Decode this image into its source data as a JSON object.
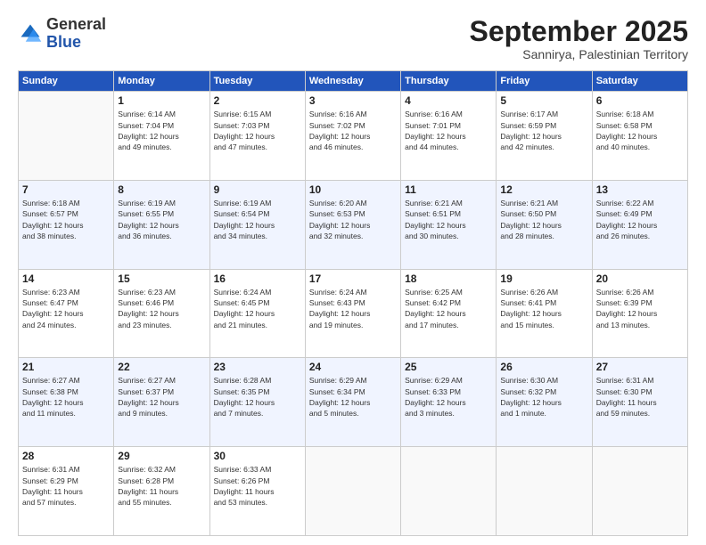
{
  "logo": {
    "general": "General",
    "blue": "Blue"
  },
  "header": {
    "month": "September 2025",
    "location": "Sannirya, Palestinian Territory"
  },
  "weekdays": [
    "Sunday",
    "Monday",
    "Tuesday",
    "Wednesday",
    "Thursday",
    "Friday",
    "Saturday"
  ],
  "weeks": [
    [
      {
        "day": "",
        "info": ""
      },
      {
        "day": "1",
        "info": "Sunrise: 6:14 AM\nSunset: 7:04 PM\nDaylight: 12 hours\nand 49 minutes."
      },
      {
        "day": "2",
        "info": "Sunrise: 6:15 AM\nSunset: 7:03 PM\nDaylight: 12 hours\nand 47 minutes."
      },
      {
        "day": "3",
        "info": "Sunrise: 6:16 AM\nSunset: 7:02 PM\nDaylight: 12 hours\nand 46 minutes."
      },
      {
        "day": "4",
        "info": "Sunrise: 6:16 AM\nSunset: 7:01 PM\nDaylight: 12 hours\nand 44 minutes."
      },
      {
        "day": "5",
        "info": "Sunrise: 6:17 AM\nSunset: 6:59 PM\nDaylight: 12 hours\nand 42 minutes."
      },
      {
        "day": "6",
        "info": "Sunrise: 6:18 AM\nSunset: 6:58 PM\nDaylight: 12 hours\nand 40 minutes."
      }
    ],
    [
      {
        "day": "7",
        "info": "Sunrise: 6:18 AM\nSunset: 6:57 PM\nDaylight: 12 hours\nand 38 minutes."
      },
      {
        "day": "8",
        "info": "Sunrise: 6:19 AM\nSunset: 6:55 PM\nDaylight: 12 hours\nand 36 minutes."
      },
      {
        "day": "9",
        "info": "Sunrise: 6:19 AM\nSunset: 6:54 PM\nDaylight: 12 hours\nand 34 minutes."
      },
      {
        "day": "10",
        "info": "Sunrise: 6:20 AM\nSunset: 6:53 PM\nDaylight: 12 hours\nand 32 minutes."
      },
      {
        "day": "11",
        "info": "Sunrise: 6:21 AM\nSunset: 6:51 PM\nDaylight: 12 hours\nand 30 minutes."
      },
      {
        "day": "12",
        "info": "Sunrise: 6:21 AM\nSunset: 6:50 PM\nDaylight: 12 hours\nand 28 minutes."
      },
      {
        "day": "13",
        "info": "Sunrise: 6:22 AM\nSunset: 6:49 PM\nDaylight: 12 hours\nand 26 minutes."
      }
    ],
    [
      {
        "day": "14",
        "info": "Sunrise: 6:23 AM\nSunset: 6:47 PM\nDaylight: 12 hours\nand 24 minutes."
      },
      {
        "day": "15",
        "info": "Sunrise: 6:23 AM\nSunset: 6:46 PM\nDaylight: 12 hours\nand 23 minutes."
      },
      {
        "day": "16",
        "info": "Sunrise: 6:24 AM\nSunset: 6:45 PM\nDaylight: 12 hours\nand 21 minutes."
      },
      {
        "day": "17",
        "info": "Sunrise: 6:24 AM\nSunset: 6:43 PM\nDaylight: 12 hours\nand 19 minutes."
      },
      {
        "day": "18",
        "info": "Sunrise: 6:25 AM\nSunset: 6:42 PM\nDaylight: 12 hours\nand 17 minutes."
      },
      {
        "day": "19",
        "info": "Sunrise: 6:26 AM\nSunset: 6:41 PM\nDaylight: 12 hours\nand 15 minutes."
      },
      {
        "day": "20",
        "info": "Sunrise: 6:26 AM\nSunset: 6:39 PM\nDaylight: 12 hours\nand 13 minutes."
      }
    ],
    [
      {
        "day": "21",
        "info": "Sunrise: 6:27 AM\nSunset: 6:38 PM\nDaylight: 12 hours\nand 11 minutes."
      },
      {
        "day": "22",
        "info": "Sunrise: 6:27 AM\nSunset: 6:37 PM\nDaylight: 12 hours\nand 9 minutes."
      },
      {
        "day": "23",
        "info": "Sunrise: 6:28 AM\nSunset: 6:35 PM\nDaylight: 12 hours\nand 7 minutes."
      },
      {
        "day": "24",
        "info": "Sunrise: 6:29 AM\nSunset: 6:34 PM\nDaylight: 12 hours\nand 5 minutes."
      },
      {
        "day": "25",
        "info": "Sunrise: 6:29 AM\nSunset: 6:33 PM\nDaylight: 12 hours\nand 3 minutes."
      },
      {
        "day": "26",
        "info": "Sunrise: 6:30 AM\nSunset: 6:32 PM\nDaylight: 12 hours\nand 1 minute."
      },
      {
        "day": "27",
        "info": "Sunrise: 6:31 AM\nSunset: 6:30 PM\nDaylight: 11 hours\nand 59 minutes."
      }
    ],
    [
      {
        "day": "28",
        "info": "Sunrise: 6:31 AM\nSunset: 6:29 PM\nDaylight: 11 hours\nand 57 minutes."
      },
      {
        "day": "29",
        "info": "Sunrise: 6:32 AM\nSunset: 6:28 PM\nDaylight: 11 hours\nand 55 minutes."
      },
      {
        "day": "30",
        "info": "Sunrise: 6:33 AM\nSunset: 6:26 PM\nDaylight: 11 hours\nand 53 minutes."
      },
      {
        "day": "",
        "info": ""
      },
      {
        "day": "",
        "info": ""
      },
      {
        "day": "",
        "info": ""
      },
      {
        "day": "",
        "info": ""
      }
    ]
  ]
}
